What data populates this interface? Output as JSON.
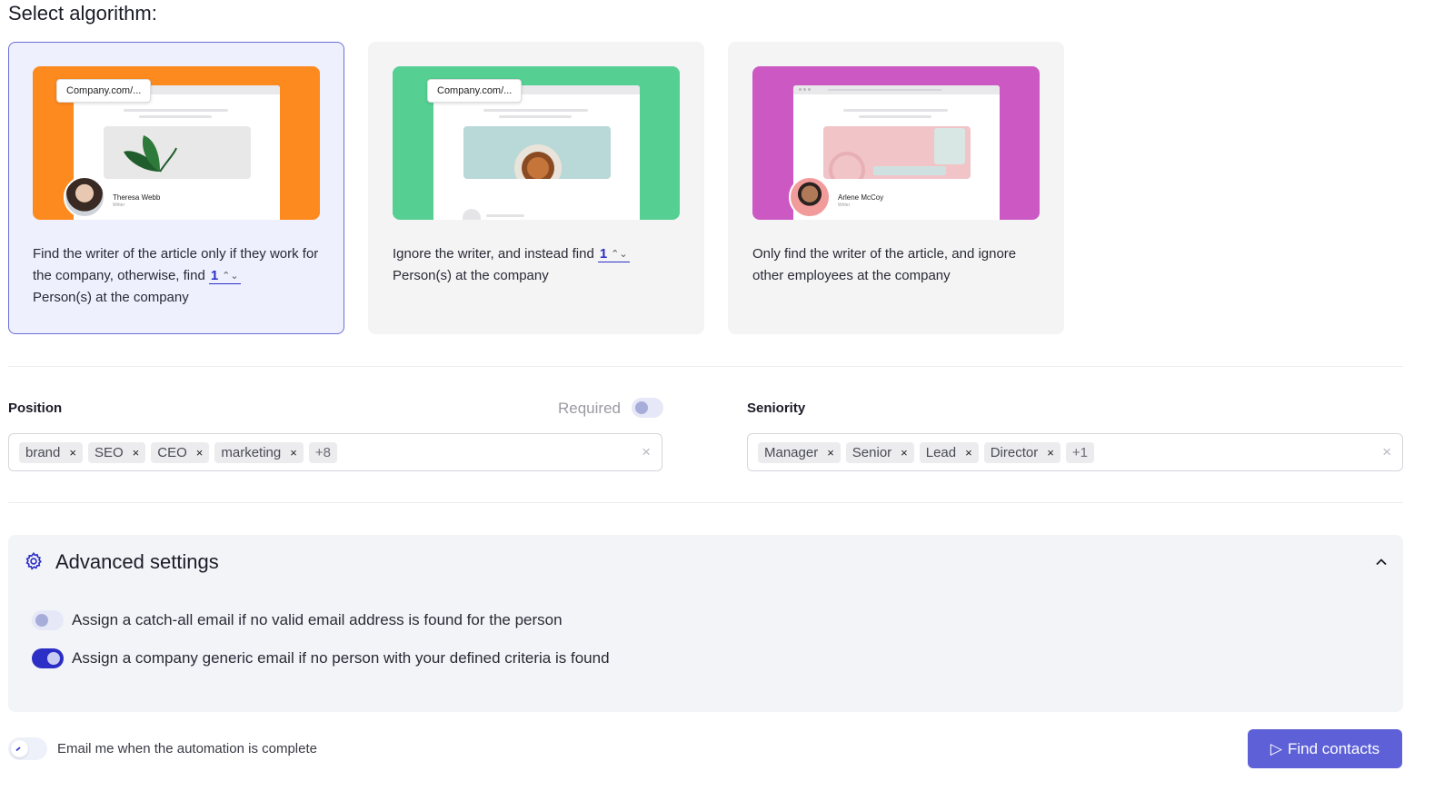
{
  "heading": "Select algorithm:",
  "colors": {
    "accent": "#2c2fc6",
    "button": "#5d60d6",
    "orange": "#fd8a1f",
    "green": "#56cf93",
    "magenta": "#cc59c3"
  },
  "algorithms": [
    {
      "url": "Company.com/...",
      "author_name": "Theresa Webb",
      "author_role": "Writer",
      "desc_before": "Find the writer of the article only if they work for the company, otherwise, find",
      "count": "1",
      "desc_after": "Person(s) at the company"
    },
    {
      "url": "Company.com/...",
      "desc_before": "Ignore the writer, and instead find",
      "count": "1",
      "desc_after": "Person(s) at the company"
    },
    {
      "author_name": "Arlene McCoy",
      "author_role": "Writer",
      "desc": "Only find the writer of the article, and ignore other employees at the company"
    }
  ],
  "position": {
    "label": "Position",
    "required_label": "Required",
    "required_on": false,
    "chips": [
      "brand",
      "SEO",
      "CEO",
      "marketing"
    ],
    "more": "+8"
  },
  "seniority": {
    "label": "Seniority",
    "chips": [
      "Manager",
      "Senior",
      "Lead",
      "Director"
    ],
    "more": "+1"
  },
  "advanced": {
    "title": "Advanced settings",
    "options": [
      {
        "label": "Assign a catch-all email if no valid email address is found for the person",
        "on": false
      },
      {
        "label": "Assign a company generic email if no person with your defined criteria is found",
        "on": true
      }
    ]
  },
  "email_notify": {
    "label": "Email me when the automation is complete",
    "on": false
  },
  "find_button": "Find contacts",
  "icons": {
    "chip_remove": "×",
    "clear": "×",
    "stepper": "⌃⌄",
    "play": "▷"
  }
}
